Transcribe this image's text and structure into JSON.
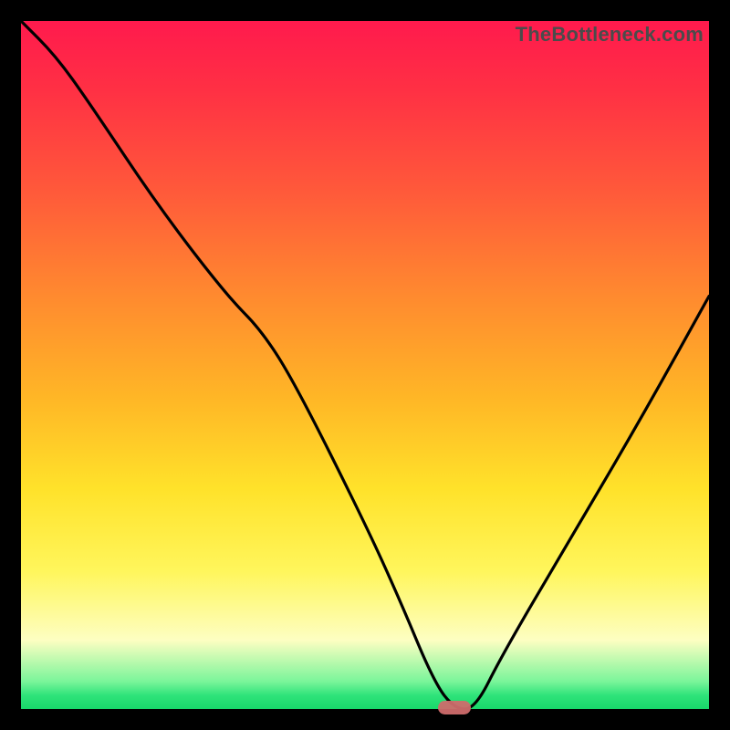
{
  "watermark": "TheBottleneck.com",
  "colors": {
    "frame": "#000000",
    "marker": "#cf6b6b",
    "curve": "#000000"
  },
  "chart_data": {
    "type": "line",
    "title": "",
    "xlabel": "",
    "ylabel": "",
    "xlim": [
      0,
      100
    ],
    "ylim": [
      0,
      100
    ],
    "legend": false,
    "grid": false,
    "annotations": [
      {
        "type": "marker",
        "x": 63,
        "y": 0,
        "shape": "pill",
        "color": "#cf6b6b"
      }
    ],
    "background_gradient": {
      "direction": "vertical",
      "stops": [
        {
          "pos": 0,
          "color": "#ff1a4d"
        },
        {
          "pos": 40,
          "color": "#ff8a2f"
        },
        {
          "pos": 68,
          "color": "#ffe22a"
        },
        {
          "pos": 90,
          "color": "#fdfec2"
        },
        {
          "pos": 100,
          "color": "#18d86b"
        }
      ]
    },
    "series": [
      {
        "name": "bottleneck-curve",
        "x": [
          0,
          5,
          10,
          20,
          30,
          35,
          40,
          50,
          55,
          60,
          63,
          66,
          70,
          80,
          90,
          100
        ],
        "values": [
          100,
          95,
          88,
          73,
          60,
          55,
          47,
          27,
          16,
          4,
          0,
          0,
          8,
          25,
          42,
          60
        ]
      }
    ]
  }
}
